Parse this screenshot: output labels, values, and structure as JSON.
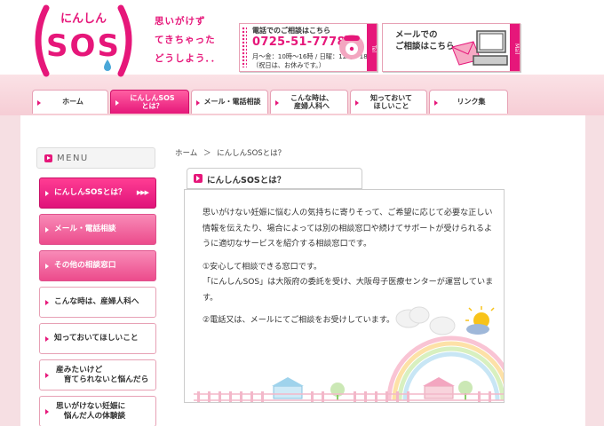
{
  "header": {
    "logo": {
      "arc_text": "にんしん",
      "main": "SOS"
    },
    "tagline": [
      "思いがけず",
      "てきちゃった",
      "どうしよう．．"
    ],
    "tel": {
      "label": "電話でのご相談はこちら",
      "number": "0725-51-7778",
      "hours": "月～金：10時～16時 / 日曜：12時～18時\n（祝日は、お休みです。）",
      "side_tab": "Tel"
    },
    "mail": {
      "label": "メールでの\nご相談はこちら",
      "side_tab": "Mail"
    }
  },
  "nav": [
    {
      "label": "ホーム"
    },
    {
      "label": "にんしんSOS\nとは？"
    },
    {
      "label": "メール・電話相談"
    },
    {
      "label": "こんな時は、\n産婦人科へ"
    },
    {
      "label": "知っておいて\nほしいこと"
    },
    {
      "label": "リンク集"
    }
  ],
  "sidebar": {
    "heading": "MENU",
    "items": [
      {
        "label": "にんしんSOSとは？",
        "arrows": "▶▶▶"
      },
      {
        "label": "メール・電話相談"
      },
      {
        "label": "その他の相談窓口"
      },
      {
        "label": "こんな時は、産婦人科へ"
      },
      {
        "label": "知っておいてほしいこと"
      },
      {
        "label": "産みたいけど\n　育てられないと悩んだら"
      },
      {
        "label": "思いがけない妊娠に\n　悩んだ人の体験談"
      }
    ]
  },
  "breadcrumb": {
    "home": "ホーム",
    "sep": "＞",
    "current": "にんしんSOSとは？"
  },
  "page": {
    "title": "にんしんSOSとは？",
    "paragraphs": [
      "思いがけない妊娠に悩む人の気持ちに寄りそって、ご希望に応じて必要な正しい情報を伝えたり、場合によっては別の相談窓口や続けてサポートが受けられるように適切なサービスを紹介する相談窓口です。",
      "①安心して相談できる窓口です。\n「にんしんSOS」は大阪府の委託を受け、大阪母子医療センターが運営しています。",
      "②電話又は、メールにてご相談をお受けしています。"
    ]
  },
  "colors": {
    "accent": "#e6177a",
    "bg_pink": "#f6dfe3"
  }
}
